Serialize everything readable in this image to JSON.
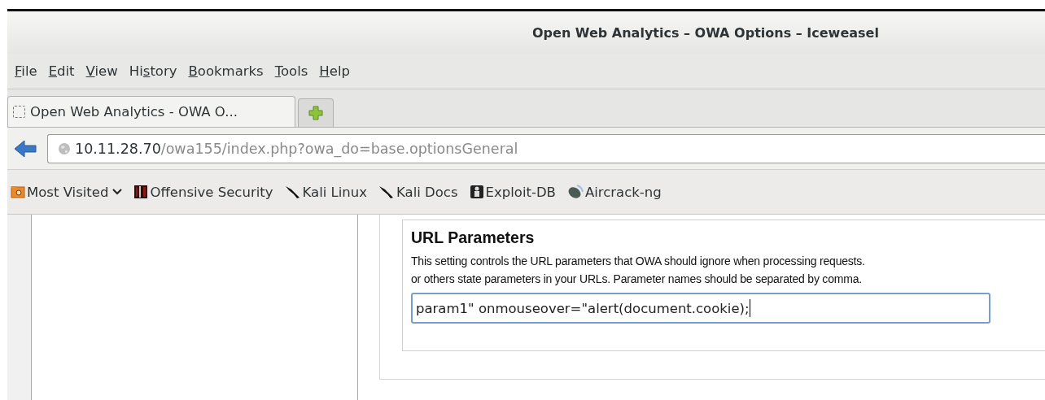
{
  "window": {
    "title": "Open Web Analytics – OWA Options – Iceweasel"
  },
  "menu": [
    {
      "key": "F",
      "post": "ile"
    },
    {
      "key": "E",
      "post": "dit"
    },
    {
      "key": "V",
      "post": "iew"
    },
    {
      "pre": "Hi",
      "key": "s",
      "post": "tory"
    },
    {
      "key": "B",
      "post": "ookmarks"
    },
    {
      "key": "T",
      "post": "ools"
    },
    {
      "key": "H",
      "post": "elp"
    }
  ],
  "tabs": [
    {
      "label": "Open Web Analytics - OWA O...",
      "selected": true
    }
  ],
  "address": {
    "host": "10.11.28.70",
    "path": "/owa155/index.php?owa_do=base.optionsGeneral"
  },
  "bookmarks": [
    {
      "label": "Most Visited",
      "kind": "folder"
    },
    {
      "label": "Offensive Security",
      "kind": "offsec"
    },
    {
      "label": "Kali Linux",
      "kind": "kali"
    },
    {
      "label": "Kali Docs",
      "kind": "kali"
    },
    {
      "label": "Exploit-DB",
      "kind": "exploit"
    },
    {
      "label": "Aircrack-ng",
      "kind": "dish"
    }
  ],
  "settings": {
    "heading": "URL Parameters",
    "description": [
      "This setting controls the URL parameters that OWA should ignore when processing requests.",
      "or others state parameters in your URLs. Parameter names should be separated by comma."
    ],
    "field": {
      "value": "param1\" onmouseover=\"alert(document.cookie);",
      "focused": true
    }
  }
}
